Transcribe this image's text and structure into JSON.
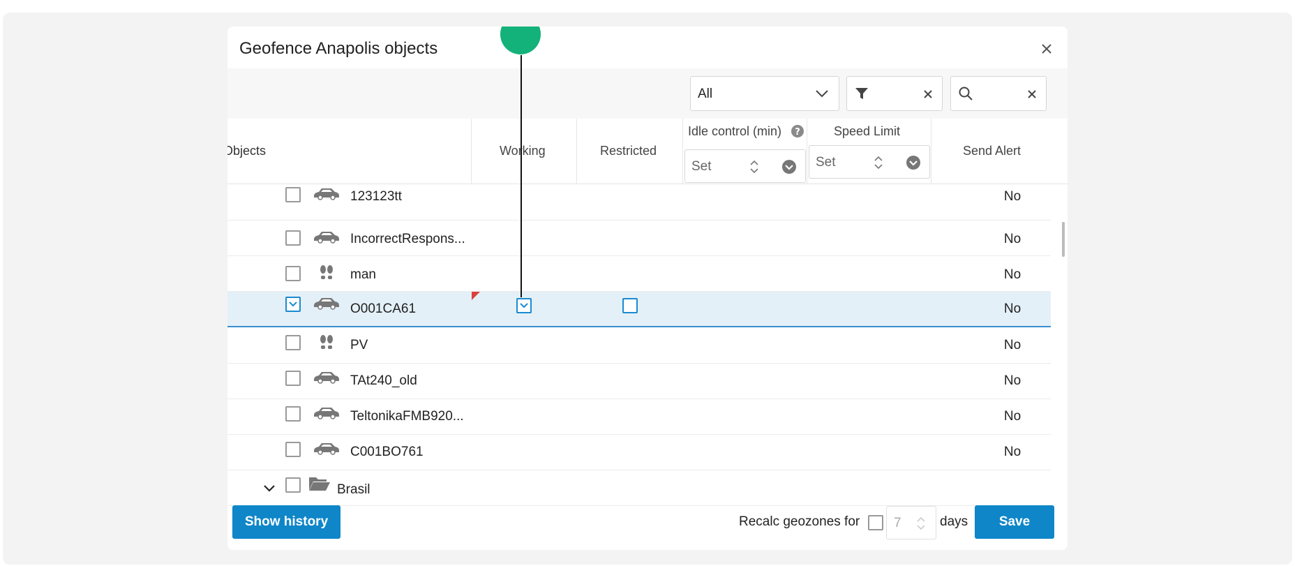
{
  "dialog": {
    "title": "Geofence Anapolis objects"
  },
  "filters": {
    "type_select": "All",
    "filter_value": "",
    "search_value": ""
  },
  "columns": {
    "objects": "Objects",
    "working": "Working",
    "restricted": "Restricted",
    "idle_control": "Idle control (min)",
    "idle_placeholder": "Set",
    "speed_limit": "Speed Limit",
    "speed_placeholder": "Set",
    "send_alert": "Send Alert"
  },
  "rows": [
    {
      "name": "123123tt",
      "icon": "car-icon",
      "checked": false,
      "send_alert": "No"
    },
    {
      "name": "IncorrectRespons...",
      "icon": "car-icon",
      "checked": false,
      "send_alert": "No"
    },
    {
      "name": "man",
      "icon": "footprints-icon",
      "checked": false,
      "send_alert": "No"
    },
    {
      "name": "O001CA61",
      "icon": "car-icon",
      "checked": true,
      "working": true,
      "restricted": false,
      "send_alert": "No"
    },
    {
      "name": "PV",
      "icon": "footprints-icon",
      "checked": false,
      "send_alert": "No"
    },
    {
      "name": "TAt240_old",
      "icon": "car-icon",
      "checked": false,
      "send_alert": "No"
    },
    {
      "name": "TeltonikaFMB920...",
      "icon": "car-icon",
      "checked": false,
      "send_alert": "No"
    },
    {
      "name": "C001BO761",
      "icon": "car-icon",
      "checked": false,
      "send_alert": "No"
    }
  ],
  "group": {
    "name": "Brasil",
    "icon": "folder-open-icon",
    "expanded": true
  },
  "footer": {
    "show_history": "Show history",
    "recalc_label": "Recalc geozones for",
    "recalc_days_value": "7",
    "days_label": "days",
    "save": "Save"
  },
  "colors": {
    "accent": "#0e86c8",
    "selected_row": "#e4f0f8",
    "marker": "#13b27a"
  }
}
